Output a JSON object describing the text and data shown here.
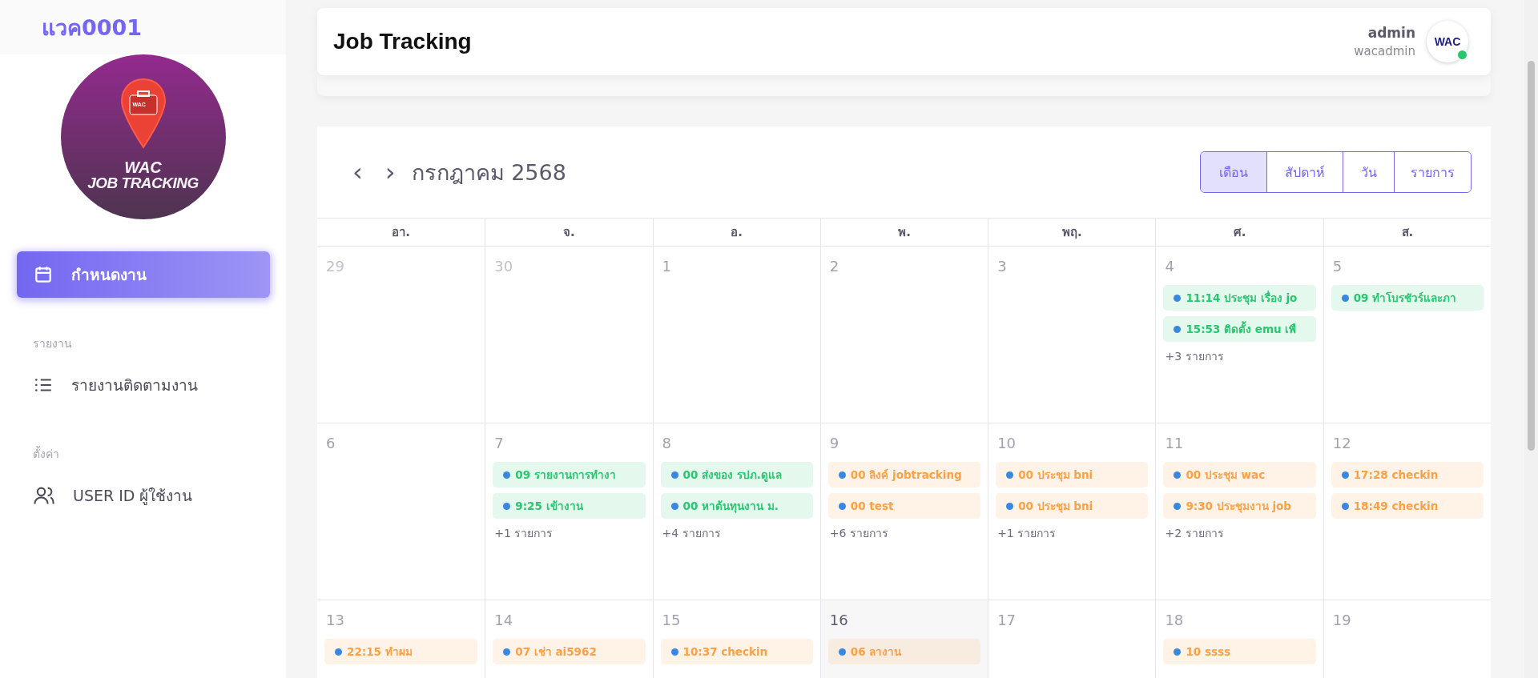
{
  "sidebar": {
    "brand": "แวค0001",
    "logo": {
      "line_1": "WAC",
      "line_2": "JOB TRACKING",
      "badge": "WAC"
    },
    "sections": [
      {
        "items": [
          {
            "label": "กำหนดงาน",
            "selected": true
          }
        ]
      },
      {
        "label": "รายงาน",
        "items": [
          {
            "label": "รายงานติดตามงาน",
            "selected": false
          }
        ]
      },
      {
        "label": "ตั้งค่า",
        "items": [
          {
            "label": "USER ID ผู้ใช้งาน",
            "selected": false
          }
        ]
      }
    ]
  },
  "header": {
    "title": "Job Tracking",
    "user_name": "admin",
    "user_id": "wacadmin",
    "avatar_text": "WAC",
    "online": true
  },
  "calendar": {
    "month": "กรกฎาคม 2568",
    "prev": "‹",
    "next": "›",
    "views": [
      {
        "label": "เดือน",
        "selected": true
      },
      {
        "label": "สัปดาห์",
        "selected": false
      },
      {
        "label": "วัน",
        "selected": false
      },
      {
        "label": "รายการ",
        "selected": false
      }
    ],
    "weekdays": [
      "อา.",
      "จ.",
      "อ.",
      "พ.",
      "พฤ.",
      "ศ.",
      "ส."
    ],
    "weeks": [
      [
        {
          "day": "29",
          "other_month": true,
          "today": false
        },
        {
          "day": "30",
          "other_month": true,
          "today": false
        },
        {
          "day": "1",
          "other_month": false,
          "today": false
        },
        {
          "day": "2",
          "other_month": false,
          "today": false
        },
        {
          "day": "3",
          "other_month": false,
          "today": false
        },
        {
          "day": "4",
          "other_month": false,
          "today": false,
          "events": [
            {
              "text": "11:14 ประชุม เรื่อง jo",
              "color": "#28c76f"
            },
            {
              "text": "15:53 ติดตั้ง emu เพื",
              "color": "#28c76f"
            }
          ],
          "more": "+3 รายการ"
        },
        {
          "day": "5",
          "other_month": false,
          "today": false,
          "events": [
            {
              "text": "09 ทำโบรชัวร์และภา",
              "color": "#28c76f"
            }
          ]
        }
      ],
      [
        {
          "day": "6",
          "other_month": false,
          "today": false
        },
        {
          "day": "7",
          "other_month": false,
          "today": false,
          "events": [
            {
              "text": "09 รายงานการทำงา",
              "color": "#28c76f"
            },
            {
              "text": "9:25 เข้างาน",
              "color": "#28c76f"
            }
          ],
          "more": "+1 รายการ"
        },
        {
          "day": "8",
          "other_month": false,
          "today": false,
          "events": [
            {
              "text": "00 ส่งของ รปภ.ดูแล",
              "color": "#28c76f"
            },
            {
              "text": "00 หาต้นทุนงาน ม.",
              "color": "#28c76f"
            }
          ],
          "more": "+4 รายการ"
        },
        {
          "day": "9",
          "other_month": false,
          "today": false,
          "events": [
            {
              "text": "00 ลิงค์ jobtracking",
              "color": "#ff9f43"
            },
            {
              "text": "00 test",
              "color": "#ff9f43"
            }
          ],
          "more": "+6 รายการ"
        },
        {
          "day": "10",
          "other_month": false,
          "today": false,
          "events": [
            {
              "text": "00 ประชุม bni",
              "color": "#ff9f43"
            },
            {
              "text": "00 ประชุม bni",
              "color": "#ff9f43"
            }
          ],
          "more": "+1 รายการ"
        },
        {
          "day": "11",
          "other_month": false,
          "today": false,
          "events": [
            {
              "text": "00 ประชุม wac",
              "color": "#ff9f43"
            },
            {
              "text": "9:30 ประชุมงาน job",
              "color": "#ff9f43"
            }
          ],
          "more": "+2 รายการ"
        },
        {
          "day": "12",
          "other_month": false,
          "today": false,
          "events": [
            {
              "text": "17:28 checkin",
              "color": "#ff9f43"
            },
            {
              "text": "18:49 checkin",
              "color": "#ff9f43"
            }
          ]
        }
      ],
      [
        {
          "day": "13",
          "other_month": false,
          "today": false,
          "events": [
            {
              "text": "22:15 ทำผม",
              "color": "#ff9f43"
            }
          ]
        },
        {
          "day": "14",
          "other_month": false,
          "today": false,
          "events": [
            {
              "text": "07 เช่า ai5962",
              "color": "#ff9f43"
            }
          ]
        },
        {
          "day": "15",
          "other_month": false,
          "today": false,
          "events": [
            {
              "text": "10:37 checkin",
              "color": "#ff9f43"
            }
          ]
        },
        {
          "day": "16",
          "other_month": false,
          "today": true,
          "events": [
            {
              "text": "06 ลางาน",
              "color": "#ff9f43"
            }
          ]
        },
        {
          "day": "17",
          "other_month": false,
          "today": false
        },
        {
          "day": "18",
          "other_month": false,
          "today": false,
          "events": [
            {
              "text": "10 ssss",
              "color": "#ff9f43"
            }
          ]
        },
        {
          "day": "19",
          "other_month": false,
          "today": false
        }
      ]
    ]
  }
}
